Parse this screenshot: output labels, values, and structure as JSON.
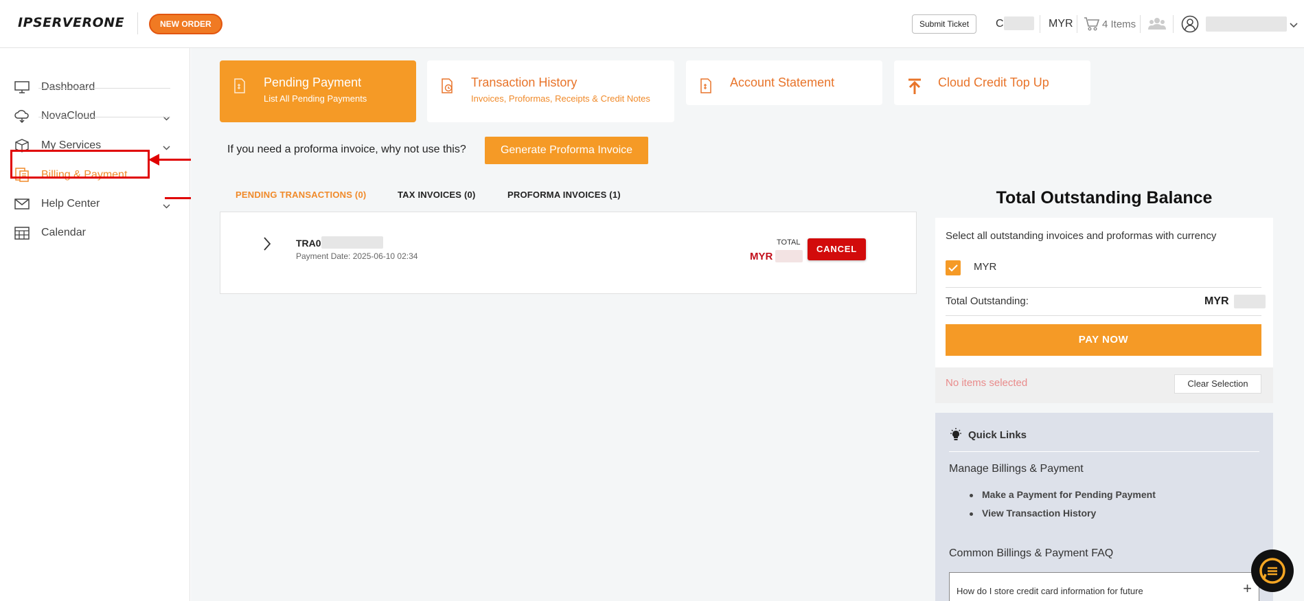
{
  "header": {
    "logo": "IPSERVERONE",
    "new_order": "NEW ORDER",
    "submit_ticket": "Submit Ticket",
    "account_initial": "C",
    "currency": "MYR",
    "cart_label": "4 Items"
  },
  "sidebar": {
    "items": [
      {
        "label": "Dashboard",
        "icon": "monitor-icon"
      },
      {
        "label": "NovaCloud",
        "icon": "cloud-icon"
      },
      {
        "label": "My Services",
        "icon": "box-icon"
      },
      {
        "label": "Billing & Payment",
        "icon": "billing-icon"
      },
      {
        "label": "Help Center",
        "icon": "mail-icon"
      },
      {
        "label": "Calendar",
        "icon": "calendar-icon"
      }
    ]
  },
  "cards": [
    {
      "title": "Pending Payment",
      "subtitle": "List All Pending Payments"
    },
    {
      "title": "Transaction History",
      "subtitle": "Invoices, Proformas, Receipts & Credit Notes"
    },
    {
      "title": "Account Statement",
      "subtitle": ""
    },
    {
      "title": "Cloud Credit Top Up",
      "subtitle": ""
    }
  ],
  "proforma": {
    "prompt": "If you need a proforma invoice, why not use this?",
    "button": "Generate Proforma Invoice"
  },
  "tabs": [
    {
      "label": "PENDING TRANSACTIONS (0)"
    },
    {
      "label": "TAX INVOICES (0)"
    },
    {
      "label": "PROFORMA INVOICES (1)"
    }
  ],
  "transaction": {
    "id": "TRA0",
    "date": "Payment Date: 2025-06-10 02:34",
    "total_label": "TOTAL",
    "amount": "MYR",
    "cancel": "CANCEL"
  },
  "balance": {
    "title": "Total Outstanding Balance",
    "select_text": "Select all outstanding invoices and proformas with currency",
    "currency_option": "MYR",
    "outstanding_label": "Total Outstanding:",
    "outstanding_currency": "MYR",
    "pay_now": "PAY NOW",
    "no_items": "No items selected",
    "clear": "Clear Selection"
  },
  "quick_links": {
    "title": "Quick Links",
    "section1": "Manage Billings & Payment",
    "links": [
      "Make a Payment for Pending Payment",
      "View Transaction History"
    ],
    "section2": "Common Billings & Payment FAQ",
    "faq_q": "How do I store credit card information for future"
  },
  "colors": {
    "accent": "#f59a26",
    "accent_text": "#e8742a",
    "danger": "#d20b0b",
    "annotation": "#e00000"
  }
}
